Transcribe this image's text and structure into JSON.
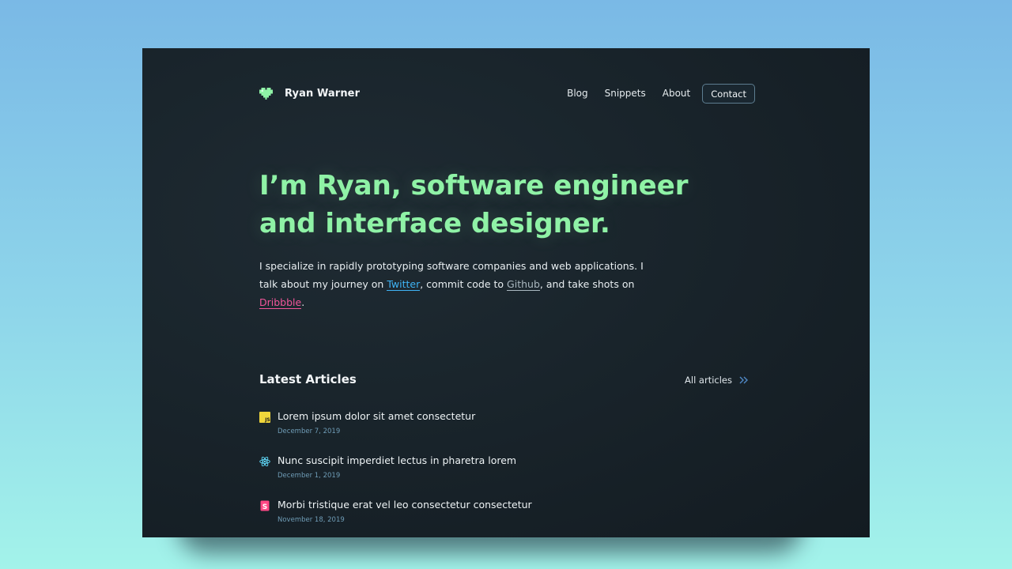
{
  "header": {
    "brand_name": "Ryan Warner",
    "brand_icon": "pixel-heart-icon",
    "nav": [
      {
        "label": "Blog"
      },
      {
        "label": "Snippets"
      },
      {
        "label": "About"
      }
    ],
    "contact_label": "Contact"
  },
  "hero": {
    "title_line1": "I’m Ryan, software engineer",
    "title_line2": "and interface designer.",
    "bio": {
      "line1": "I specialize in rapidly prototyping software companies and web applications. I",
      "part2a": "talk about my journey on ",
      "twitter": "Twitter",
      "part2b": ", commit code to ",
      "github": "Github",
      "part2c": ", and take shots on",
      "dribbble": "Dribbble",
      "end": "."
    }
  },
  "articles": {
    "section_title": "Latest Articles",
    "all_label": "All articles",
    "all_icon": "double-chevron-right-icon",
    "items": [
      {
        "title": "Lorem ipsum dolor sit amet consectetur",
        "date": "December 7, 2019",
        "icon": "javascript-icon"
      },
      {
        "title": "Nunc suscipit imperdiet lectus in pharetra lorem",
        "date": "December 1, 2019",
        "icon": "react-icon"
      },
      {
        "title": "Morbi tristique erat vel leo consectetur consectetur",
        "date": "November 18, 2019",
        "icon": "storybook-icon"
      }
    ]
  },
  "colors": {
    "accent_green": "#8ff2a6",
    "twitter": "#3fb3f5",
    "dribbble": "#f2559a",
    "date": "#6f9cb6"
  }
}
